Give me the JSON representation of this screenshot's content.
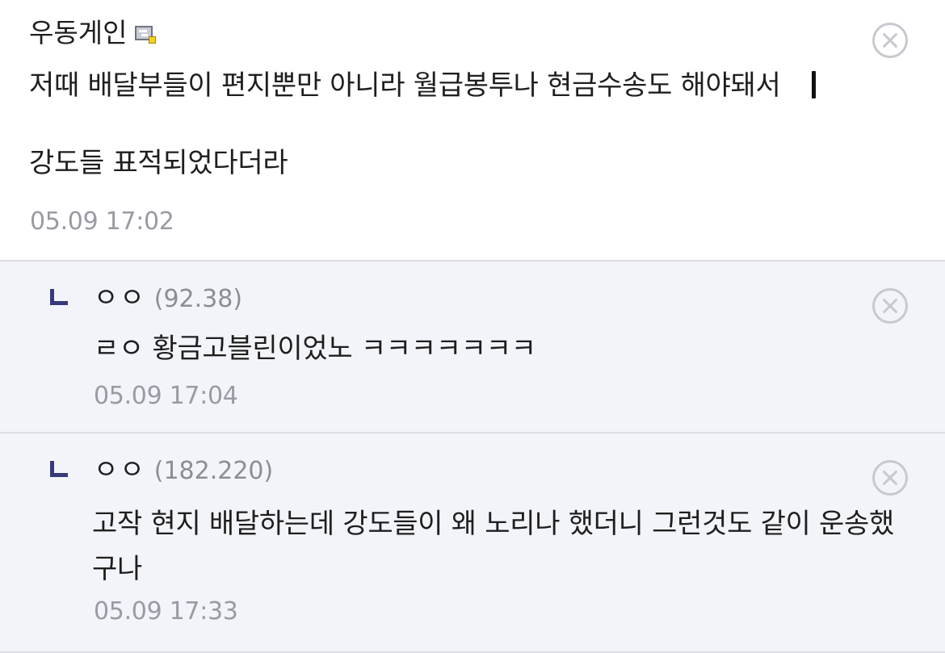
{
  "comments": [
    {
      "nickname": "우동게인",
      "icon": "gallog-icon",
      "body": "저때 배달부들이 편지뿐만 아니라 월급봉투나 현금수송도 해야돼서\n\n강도들 표적되었다더라",
      "time": "05.09 17:02"
    }
  ],
  "replies": [
    {
      "nickname": "ㅇㅇ",
      "ip": "(92.38)",
      "body": "ㄹㅇ 황금고블린이었노 ㅋㅋㅋㅋㅋㅋㅋ",
      "time": "05.09 17:04"
    },
    {
      "nickname": "ㅇㅇ",
      "ip": "(182.220)",
      "body": "고작 현지 배달하는데 강도들이 왜 노리나 했더니 그런것도 같이 운송했구나",
      "time": "05.09 17:33"
    }
  ],
  "colors": {
    "reply_background": "#f3f4f9",
    "reply_marker": "#36397a",
    "meta_text": "#9a9aa4",
    "delete_icon": "#c8c8cf"
  },
  "icons": {
    "delete": "close-circle-icon",
    "reply": "reply-arrow-icon",
    "gallog": "gallog-icon"
  }
}
